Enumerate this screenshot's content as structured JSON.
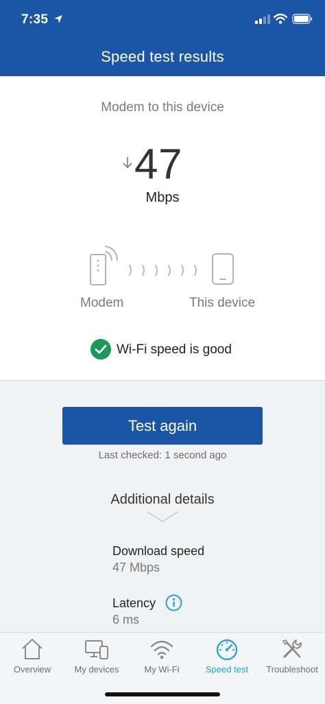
{
  "status_bar": {
    "time": "7:35"
  },
  "header": {
    "title": "Speed test results"
  },
  "result": {
    "path_label": "Modem to this device",
    "speed_value": "47",
    "speed_unit": "Mbps",
    "modem_label": "Modem",
    "device_label": "This device",
    "status_text": "Wi-Fi speed is good"
  },
  "actions": {
    "test_again_label": "Test again",
    "last_checked": "Last checked: 1 second ago"
  },
  "details": {
    "title": "Additional details",
    "download_label": "Download speed",
    "download_value": "47 Mbps",
    "latency_label": "Latency",
    "latency_value": "6 ms"
  },
  "tabs": [
    {
      "label": "Overview",
      "icon": "home-icon"
    },
    {
      "label": "My devices",
      "icon": "devices-icon"
    },
    {
      "label": "My Wi-Fi",
      "icon": "wifi-icon"
    },
    {
      "label": "Speed test",
      "icon": "speedometer-icon",
      "active": true
    },
    {
      "label": "Troubleshoot",
      "icon": "tools-icon"
    }
  ],
  "colors": {
    "brand_blue": "#1b56a6",
    "success_green": "#1a9a56",
    "active_tab": "#1ea0dc"
  }
}
